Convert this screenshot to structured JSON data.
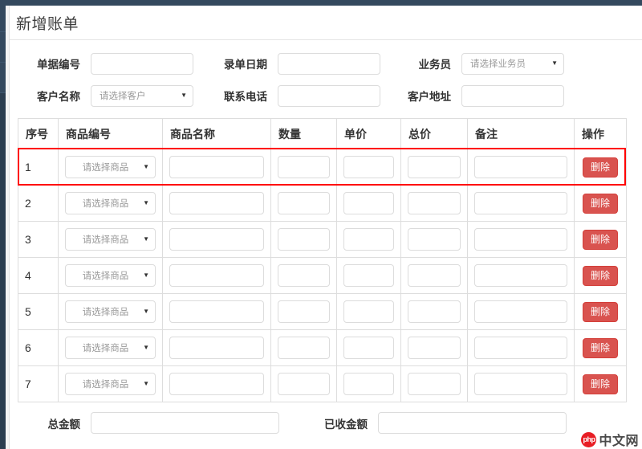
{
  "window": {
    "accent_navy": "#34495e",
    "sidebar_navy": "#2c3e50",
    "danger_red": "#d9534f",
    "highlight_red": "#ff0000"
  },
  "panel": {
    "title": "新增账单"
  },
  "form": {
    "rows": [
      {
        "fields": [
          {
            "label": "单据编号",
            "type": "text",
            "value": "",
            "placeholder": ""
          },
          {
            "label": "录单日期",
            "type": "text",
            "value": "",
            "placeholder": ""
          },
          {
            "label": "业务员",
            "type": "select",
            "value": "请选择业务员"
          }
        ]
      },
      {
        "fields": [
          {
            "label": "客户名称",
            "type": "select",
            "value": "请选择客户"
          },
          {
            "label": "联系电话",
            "type": "text",
            "value": "",
            "placeholder": ""
          },
          {
            "label": "客户地址",
            "type": "text",
            "value": "",
            "placeholder": ""
          }
        ]
      }
    ]
  },
  "table": {
    "headers": [
      "序号",
      "商品编号",
      "商品名称",
      "数量",
      "单价",
      "总价",
      "备注",
      "操作"
    ],
    "delete_label": "删除",
    "product_placeholder": "请选择商品",
    "highlighted_row_index": 0,
    "rows": [
      {
        "index": "1",
        "product_code": "请选择商品",
        "product_name": "",
        "qty": "",
        "price": "",
        "total": "",
        "note": ""
      },
      {
        "index": "2",
        "product_code": "请选择商品",
        "product_name": "",
        "qty": "",
        "price": "",
        "total": "",
        "note": ""
      },
      {
        "index": "3",
        "product_code": "请选择商品",
        "product_name": "",
        "qty": "",
        "price": "",
        "total": "",
        "note": ""
      },
      {
        "index": "4",
        "product_code": "请选择商品",
        "product_name": "",
        "qty": "",
        "price": "",
        "total": "",
        "note": ""
      },
      {
        "index": "5",
        "product_code": "请选择商品",
        "product_name": "",
        "qty": "",
        "price": "",
        "total": "",
        "note": ""
      },
      {
        "index": "6",
        "product_code": "请选择商品",
        "product_name": "",
        "qty": "",
        "price": "",
        "total": "",
        "note": ""
      },
      {
        "index": "7",
        "product_code": "请选择商品",
        "product_name": "",
        "qty": "",
        "price": "",
        "total": "",
        "note": ""
      }
    ]
  },
  "footer": {
    "total_amount_label": "总金额",
    "total_amount_value": "",
    "received_amount_label": "已收金额",
    "received_amount_value": ""
  },
  "watermark": {
    "badge": "php",
    "text": "中文网"
  }
}
